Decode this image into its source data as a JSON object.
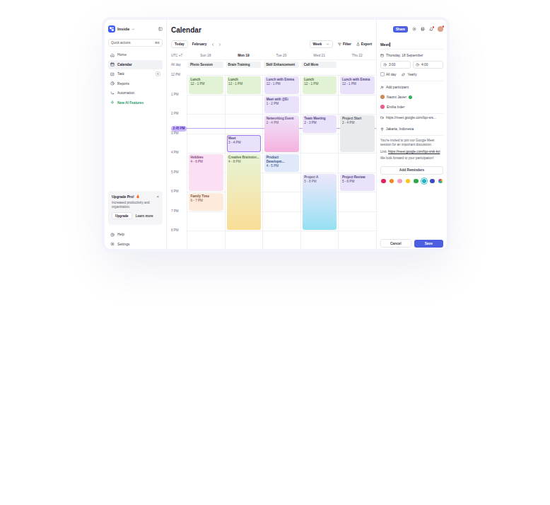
{
  "sidebar": {
    "brand": "Inside",
    "quick_actions": {
      "placeholder": "Quick actions",
      "shortcut": "⌘K"
    },
    "items": [
      {
        "label": "Home",
        "selected": false,
        "kind": "nav"
      },
      {
        "label": "Calendar",
        "selected": true,
        "kind": "nav"
      },
      {
        "label": "Task",
        "selected": false,
        "kind": "nav",
        "badge": "8"
      },
      {
        "label": "Reports",
        "selected": false,
        "kind": "nav"
      },
      {
        "label": "Automation",
        "selected": false,
        "kind": "nav"
      },
      {
        "label": "New AI Features",
        "selected": false,
        "kind": "promo"
      }
    ],
    "upgrade": {
      "title": "Upgrade Pro!",
      "text": "Increased productivity and organization.",
      "primary": "Upgrade",
      "secondary": "Learn more",
      "close": "×"
    },
    "footer_items": [
      {
        "label": "Help"
      },
      {
        "label": "Settings"
      }
    ]
  },
  "calendar": {
    "title": "Calendar",
    "toolbar": {
      "today": "Today",
      "month": "February",
      "view": "Week",
      "filter": "Filter",
      "export": "Export"
    },
    "timezone": "UTC +7",
    "all_day_label": "All day",
    "hours": [
      "12 PM",
      "1 PM",
      "2 PM",
      "3 PM",
      "4 PM",
      "5 PM",
      "6 PM",
      "7 PM",
      "8 PM"
    ],
    "now": "2:45 PM",
    "days": [
      {
        "label": "Sun 18",
        "selected": false,
        "all_day": [
          "Photo Session"
        ],
        "events": [
          {
            "title": "Lunch",
            "time": "12 - 1 PM",
            "color": "#7cc242",
            "kind": "solid",
            "selected": false
          },
          {
            "title": "Hobbies",
            "time": "4 - 6 PM",
            "color": "#ec6fc4",
            "kind": "solid",
            "selected": false
          },
          {
            "title": "Family Time",
            "time": "6 - 7 PM",
            "color": "#f5a05c",
            "kind": "solid",
            "selected": false
          }
        ]
      },
      {
        "label": "Mon 19",
        "selected": true,
        "all_day": [
          "Brain Training"
        ],
        "events": [
          {
            "title": "Lunch",
            "time": "12 - 1 PM",
            "color": "#7cc242",
            "kind": "solid",
            "selected": false
          },
          {
            "title": "Meet",
            "time": "3 - 4 PM",
            "color": "#9b7bea",
            "kind": "solid",
            "selected": true
          },
          {
            "title": "Creative Brainstor...",
            "time": "4 - 8 PM",
            "color": "#a8d86e",
            "color_end": "#f6c23e",
            "kind": "gradient",
            "selected": false
          }
        ]
      },
      {
        "label": "Tue 20",
        "selected": false,
        "all_day": [
          "Skill Enhancement"
        ],
        "events": [
          {
            "title": "Lunch with Emma",
            "time": "12 - 1 PM",
            "color": "#9b7bea",
            "kind": "solid",
            "selected": false
          },
          {
            "title": "Meet with @Ei",
            "time": "1 - 2 PM",
            "color": "#9b7bea",
            "kind": "solid",
            "selected": false
          },
          {
            "title": "Networking Event",
            "time": "2 - 4 PM",
            "color": "#c59bf0",
            "color_end": "#ec6fc4",
            "kind": "gradient",
            "selected": false
          },
          {
            "title": "Product Developm...",
            "time": "4 - 5 PM",
            "color": "#6f9be8",
            "kind": "solid",
            "selected": false
          }
        ]
      },
      {
        "label": "Wed 21",
        "selected": false,
        "all_day": [
          "Call Mom"
        ],
        "events": [
          {
            "title": "Lunch",
            "time": "12 - 1 PM",
            "color": "#7cc242",
            "kind": "solid",
            "selected": false
          },
          {
            "title": "Team Meeting",
            "time": "2 - 3 PM",
            "color": "#9b7bea",
            "kind": "solid",
            "selected": false
          },
          {
            "title": "Project A",
            "time": "5 - 8 PM",
            "color": "#b9a6f3",
            "color_end": "#3dc7e8",
            "kind": "gradient",
            "selected": false
          }
        ]
      },
      {
        "label": "Thu 22",
        "selected": false,
        "all_day": [],
        "events": [
          {
            "title": "Lunch with Emma",
            "time": "12 - 1 PM",
            "color": "#9b7bea",
            "kind": "solid",
            "selected": false
          },
          {
            "title": "Project Start",
            "time": "2 - 4 PM",
            "color": "#9aa0aa",
            "kind": "solid",
            "selected": false
          },
          {
            "title": "Project Review",
            "time": "5 - 6 PM",
            "color": "#9b7bea",
            "kind": "solid",
            "selected": false
          }
        ]
      }
    ]
  },
  "header_actions": {
    "share": "Share"
  },
  "event_form": {
    "title": "Meet",
    "date": "Thursday, 18 September",
    "start": "3:00",
    "end": "4:00",
    "all_day": {
      "label": "All day",
      "checked": false
    },
    "repeat": "Yearly",
    "add_participant": "Add participant",
    "participants": [
      {
        "name": "Naomi Javier",
        "confirmed": true,
        "color": "#c98a5a"
      },
      {
        "name": "Emilia Inder",
        "confirmed": false,
        "color": "#e85d8a"
      }
    ],
    "meet_link": "https://meet.google.com/lqo-srs...",
    "location": "Jakarta, Indonesia",
    "description": "You're invited to join our Google Meet session for an important discussion.",
    "link_label": "Link:",
    "link": "https://meet.google.com/lqo-srsk-kvi",
    "closing": "We look forward to your participation!",
    "reminders": "Add Reminders",
    "colors": [
      {
        "color": "#e0245e",
        "kind": "solid",
        "selected": false
      },
      {
        "color": "#f08a24",
        "kind": "solid",
        "selected": false
      },
      {
        "color": "#f49ac1",
        "kind": "solid",
        "selected": false
      },
      {
        "color": "#f5c518",
        "kind": "solid",
        "selected": false
      },
      {
        "color": "#2aa84a",
        "kind": "solid",
        "selected": false
      },
      {
        "color": "#17b5c8",
        "kind": "solid",
        "selected": true
      },
      {
        "color": "#3b4cc0",
        "kind": "solid",
        "selected": false
      },
      {
        "color": "#7b61ff",
        "kind": "custom",
        "selected": false
      }
    ],
    "cancel": "Cancel",
    "save": "Save"
  }
}
